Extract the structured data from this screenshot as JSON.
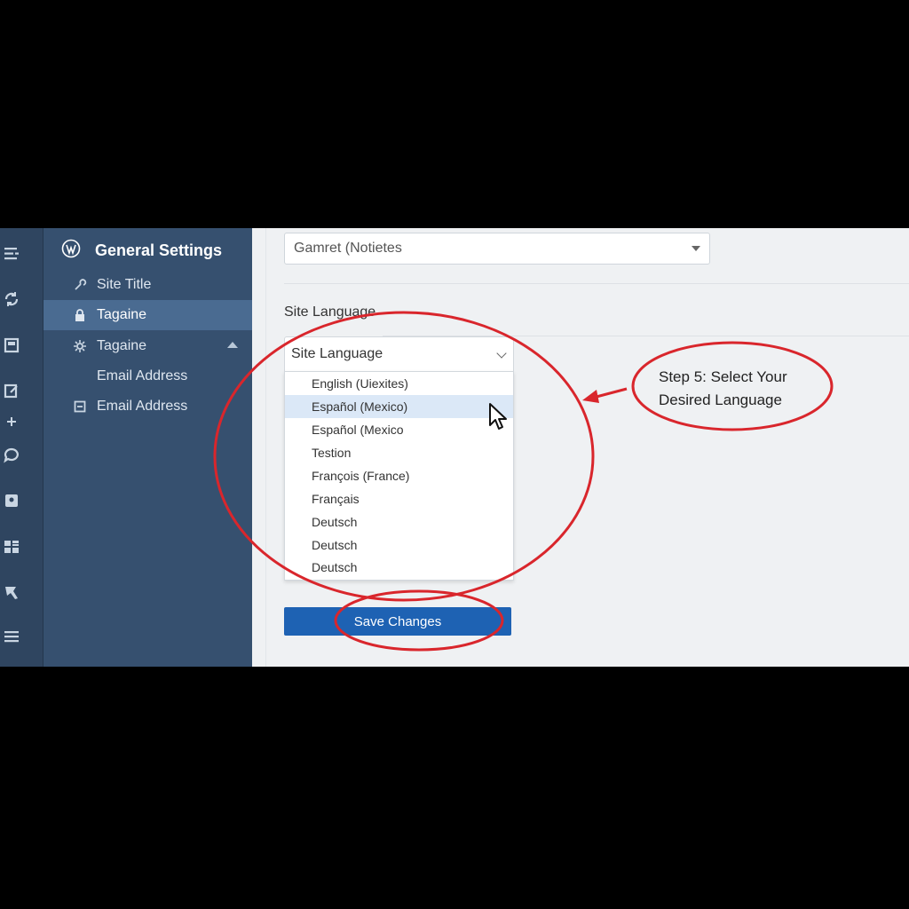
{
  "sidebar": {
    "title": "General Settings",
    "items": [
      {
        "label": "Site Title",
        "icon": "wrench-icon"
      },
      {
        "label": "Tagaine",
        "icon": "lock-icon",
        "active": true
      },
      {
        "label": "Tagaine",
        "icon": "gear-icon",
        "expanded": true
      },
      {
        "label": "Email Address",
        "icon": ""
      },
      {
        "label": "Email Address",
        "icon": "envelope-icon"
      }
    ]
  },
  "rail": {
    "icons": [
      "menu-icon",
      "sync-icon",
      "posts-icon",
      "edit-icon",
      "plus-icon",
      "comment-icon",
      "media-icon",
      "grid-icon",
      "pointer-icon",
      "list-icon"
    ]
  },
  "main": {
    "top_select": {
      "value": "Gamret (Notietes"
    },
    "field_label": "Site Language",
    "language_select": {
      "value": "Site Language",
      "options": [
        "English (Uiexites)",
        "Español (Mexico)",
        "Español (Mexico",
        "Testion",
        "François (France)",
        "Français",
        "Deutsch",
        "Deutsch",
        "Deutsch"
      ],
      "highlighted_index": 1
    },
    "save_button": "Save Changes"
  },
  "annotation": {
    "callout_line1": "Step 5: Select Your",
    "callout_line2": "Desired Language",
    "color": "#d9262c"
  },
  "colors": {
    "sidebar_bg": "#36506f",
    "rail_bg": "#2f4560",
    "active_item": "#4a6b91",
    "primary_button": "#1e62b3",
    "highlight_option": "#dbe8f7"
  }
}
